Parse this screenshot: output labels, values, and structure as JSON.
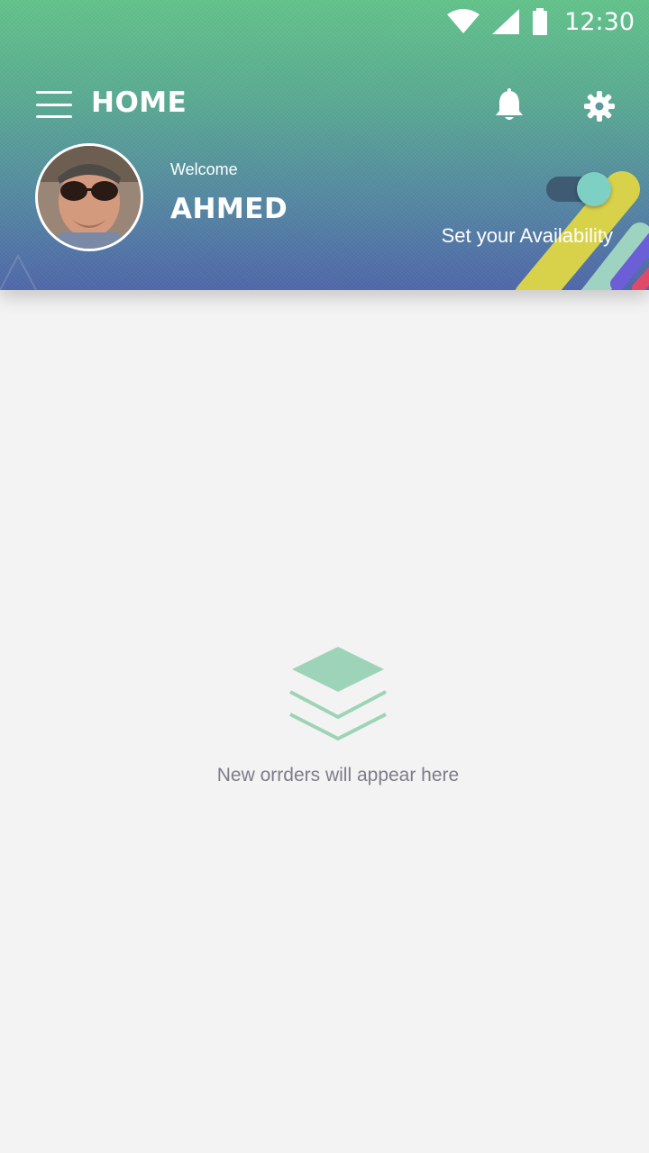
{
  "status_bar": {
    "time": "12:30",
    "icons": [
      "wifi-icon",
      "signal-icon",
      "battery-icon"
    ]
  },
  "header": {
    "title": "HOME",
    "menu_icon": "hamburger-menu-icon",
    "notifications_icon": "bell-icon",
    "settings_icon": "gear-icon"
  },
  "profile": {
    "welcome": "Welcome",
    "name": "AHMED"
  },
  "availability": {
    "label": "Set your Availability",
    "enabled": true
  },
  "empty_state": {
    "icon": "layers-icon",
    "message": "New orrders will appear here"
  },
  "colors": {
    "header_gradient_top": "#63c38b",
    "header_gradient_bottom": "#5067aa",
    "toggle_knob": "#7fd0c4",
    "toggle_track": "#3f5a73",
    "empty_icon": "#9dd4b9",
    "background": "#f3f3f3"
  }
}
